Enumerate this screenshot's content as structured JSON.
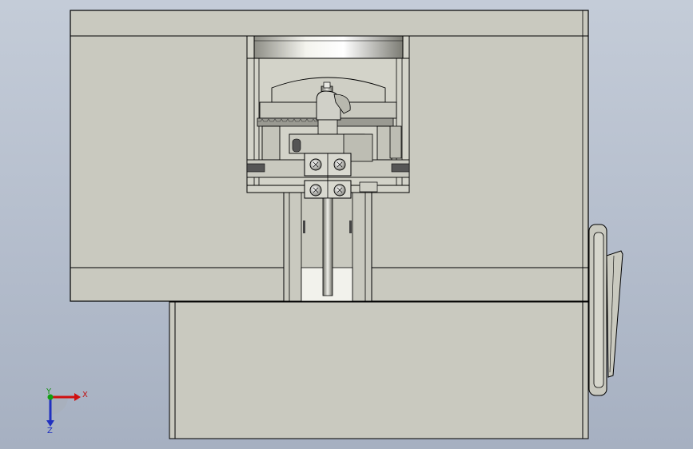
{
  "view": {
    "background": [
      "#c4ccd8",
      "#a6b0c1"
    ],
    "part_fill": "#c9c9bf",
    "part_edge": "#000000"
  },
  "triad": {
    "x_label": "X",
    "y_label": "Y",
    "z_label": "Z",
    "colors": {
      "x": "#d01010",
      "y": "#10a010",
      "z": "#2030c0"
    }
  }
}
